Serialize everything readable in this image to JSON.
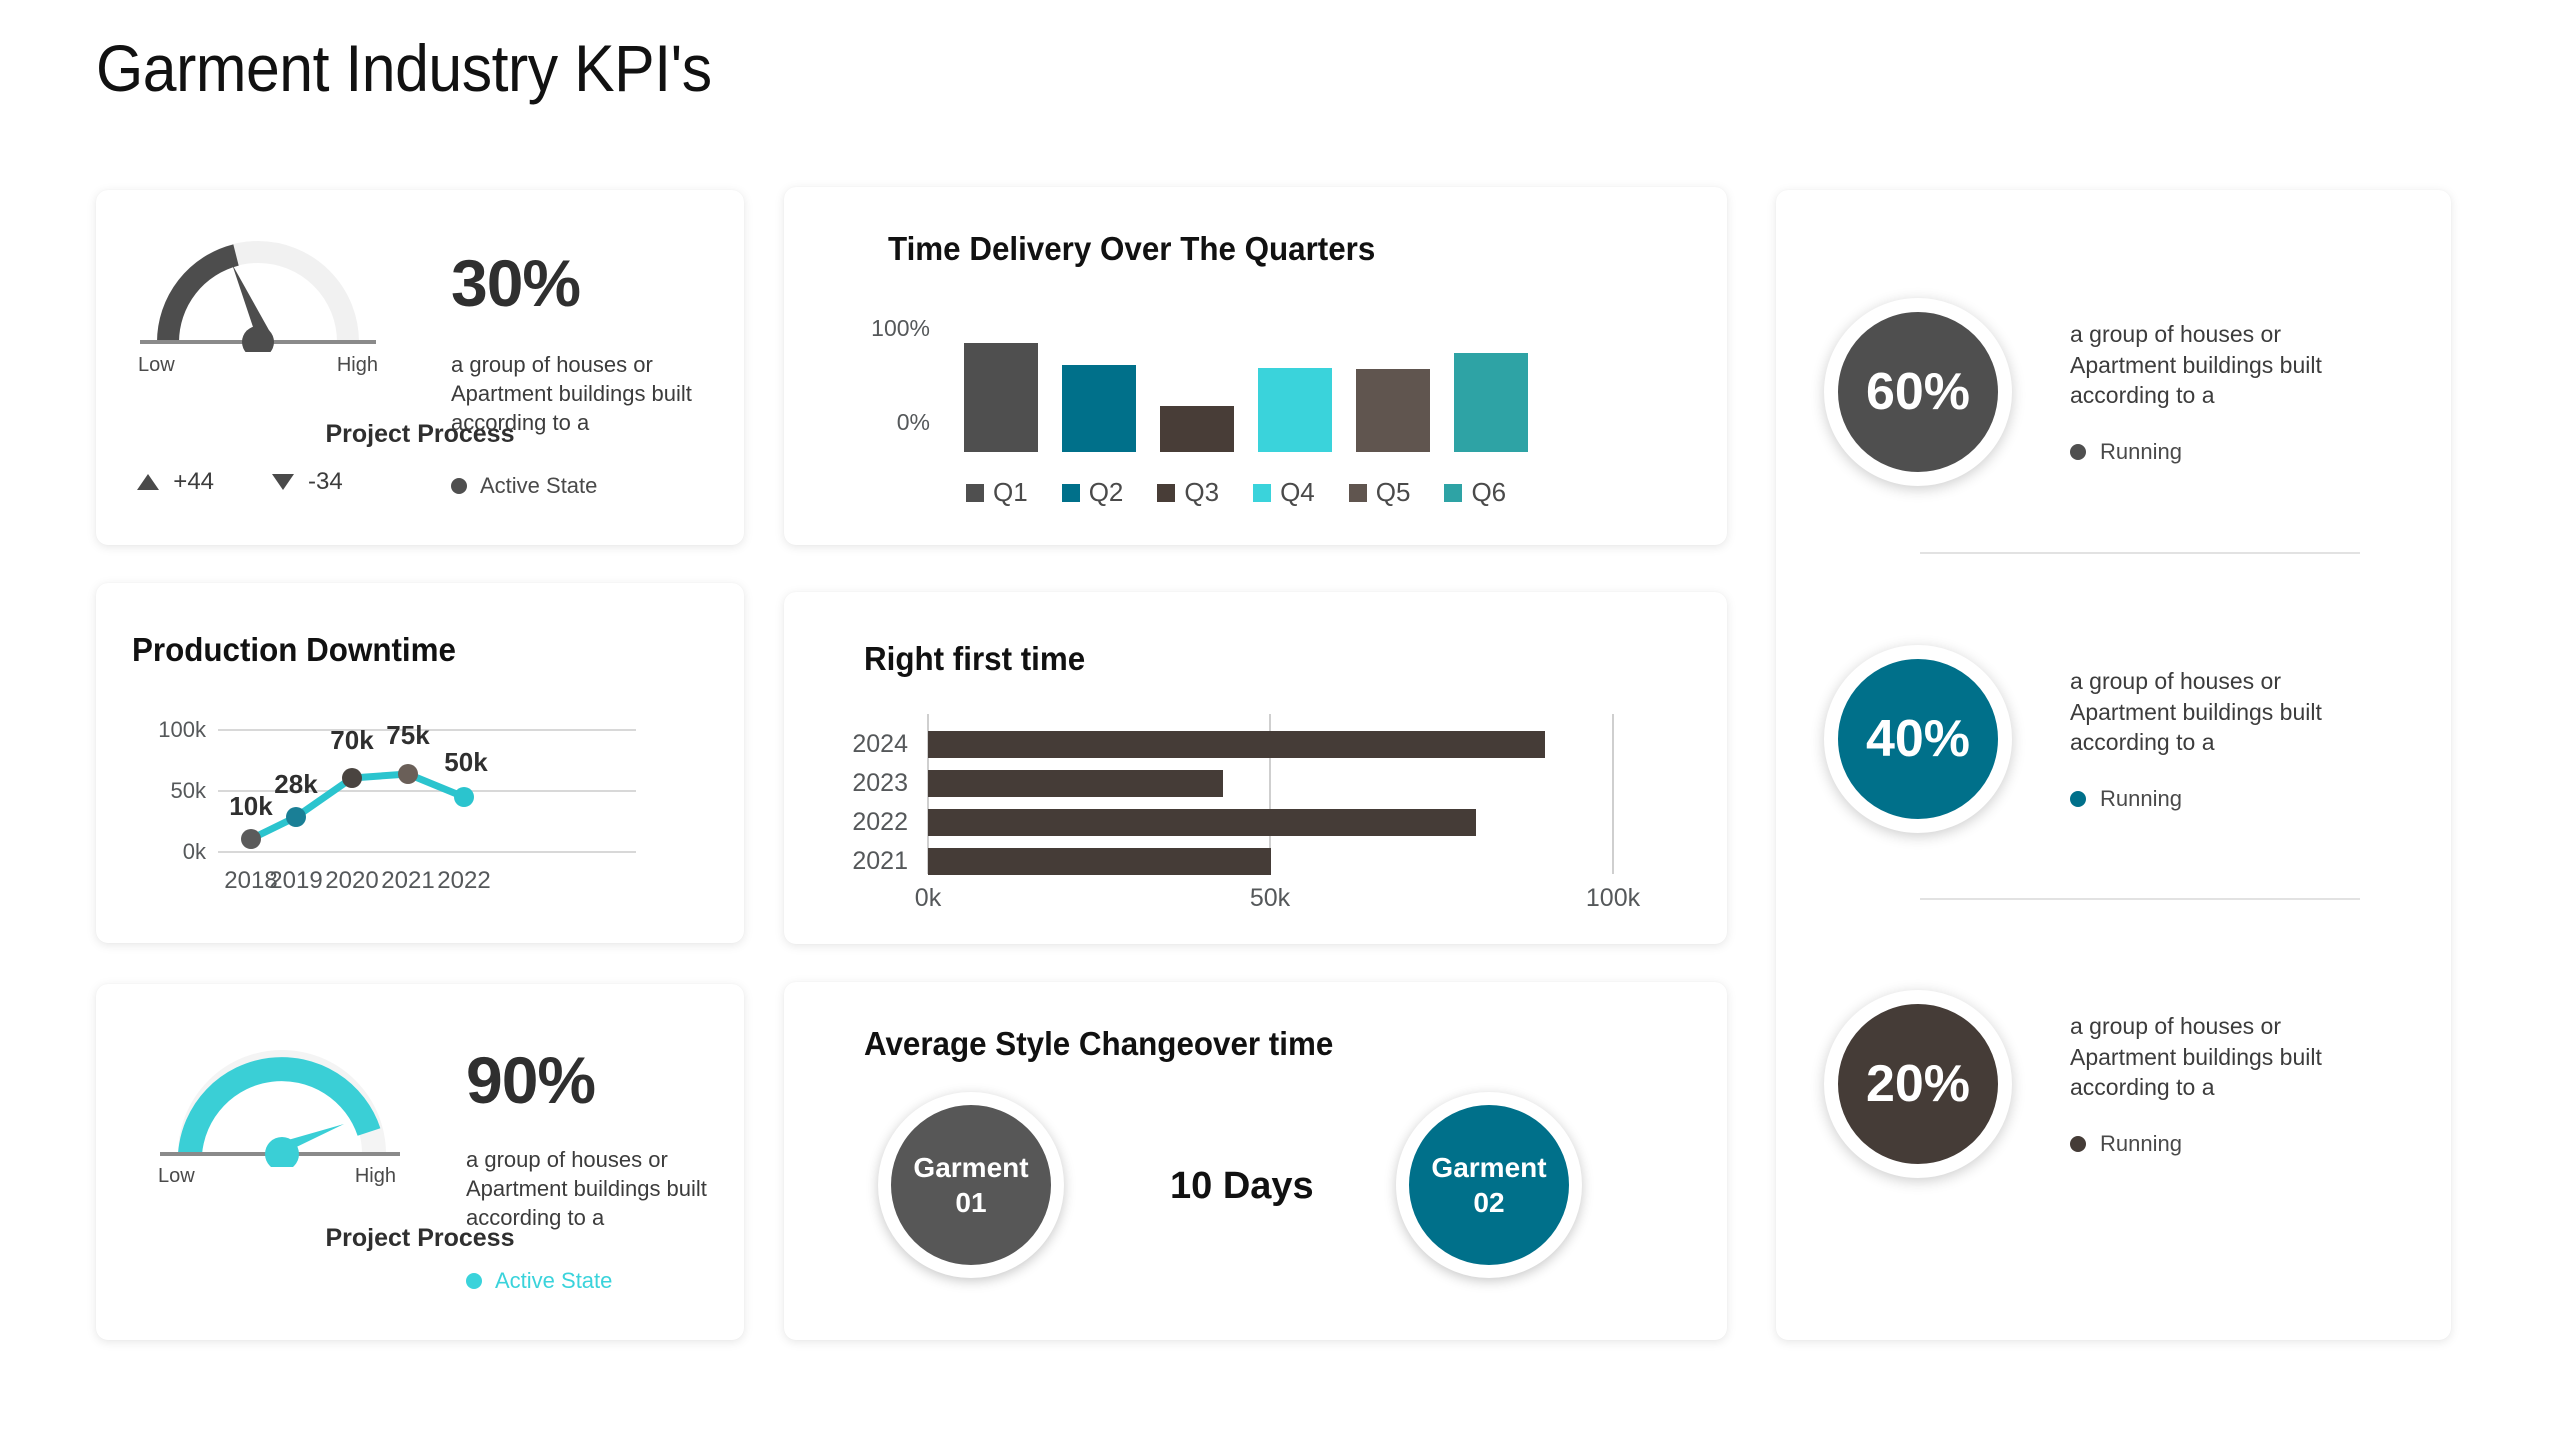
{
  "page": {
    "title": "Garment Industry KPI's",
    "background_color": "#ffffff"
  },
  "palette": {
    "gray": "#4F4F4F",
    "teal_blue": "#00708A",
    "dark_brown": "#453C37",
    "cyan": "#3AD3DB",
    "warm_gray": "#60554F",
    "teal": "#2EA3A5",
    "line_cyan": "#2BC4CE",
    "text": "#2f2f2f",
    "muted": "#55585a"
  },
  "gauge_top": {
    "card_name": "project-process-gauge-top",
    "value_percent": 30,
    "value_label": "30%",
    "low_label": "Low",
    "high_label": "High",
    "caption": "Project Process",
    "delta_up": "+44",
    "delta_down": "-34",
    "description": "a group of houses or Apartment buildings built according to a",
    "status_label": "Active State",
    "status_color": "#4F4F4F",
    "arc_color": "#4F4F4F",
    "track_color": "#f0f0f0"
  },
  "gauge_bottom": {
    "card_name": "project-process-gauge-bottom",
    "value_percent": 90,
    "value_label": "90%",
    "low_label": "Low",
    "high_label": "High",
    "caption": "Project Process",
    "description": "a group of houses or Apartment buildings built according to a",
    "status_label": "Active State",
    "status_color": "#3AD3DB",
    "arc_color": "#3AD3DB",
    "track_color": "#f2f2f2"
  },
  "changeover": {
    "title": "Average Style Changeover time",
    "days_label": "10 Days",
    "bubbles": [
      {
        "line1": "Garment",
        "line2": "01",
        "color": "#575757"
      },
      {
        "line1": "Garment",
        "line2": "02",
        "color": "#00708A"
      }
    ]
  },
  "right_stats": [
    {
      "value": "60%",
      "color": "#4F4F4F",
      "description": "a group of houses or Apartment buildings built according to a",
      "status_label": "Running",
      "status_color": "#4F4F4F"
    },
    {
      "value": "40%",
      "color": "#00708A",
      "description": "a group of houses or Apartment buildings built according to a",
      "status_label": "Running",
      "status_color": "#00708A"
    },
    {
      "value": "20%",
      "color": "#453C37",
      "description": "a group of houses or Apartment buildings built according to a",
      "status_label": "Running",
      "status_color": "#453C37"
    }
  ],
  "chart_data": [
    {
      "id": "time-delivery",
      "type": "bar",
      "title": "Time Delivery Over The Quarters",
      "xlabel": "",
      "ylabel": "",
      "categories": [
        "Q1",
        "Q2",
        "Q3",
        "Q4",
        "Q5",
        "Q6"
      ],
      "values": [
        75,
        60,
        32,
        58,
        57,
        68
      ],
      "ylim": [
        0,
        100
      ],
      "ytick_labels": [
        "100%",
        "0%"
      ],
      "ytick_values": [
        100,
        0
      ],
      "grid": false,
      "legend_position": "bottom",
      "legend": [
        "Q1",
        "Q2",
        "Q3",
        "Q4",
        "Q5",
        "Q6"
      ],
      "colors": [
        "#4F4F4F",
        "#00708A",
        "#483D37",
        "#3AD3DB",
        "#60554F",
        "#2EA3A5"
      ]
    },
    {
      "id": "production-downtime",
      "type": "line",
      "title": "Production Downtime",
      "xlabel": "",
      "ylabel": "",
      "categories": [
        "2018",
        "2019",
        "2020",
        "2021",
        "2022"
      ],
      "values": [
        10000,
        28000,
        70000,
        75000,
        50000
      ],
      "data_labels": [
        "10k",
        "28k",
        "70k",
        "75k",
        "50k"
      ],
      "ylim": [
        0,
        100000
      ],
      "ytick_labels": [
        "100k",
        "50k",
        "0k"
      ],
      "ytick_values": [
        100000,
        50000,
        0
      ],
      "grid": true,
      "line_color": "#2BC4CE",
      "marker_colors": [
        "#5b5b5b",
        "#1a7f96",
        "#4a4440",
        "#6a5f58",
        "#2BC4CE"
      ],
      "legend_position": "none"
    },
    {
      "id": "right-first-time",
      "type": "bar",
      "orientation": "horizontal",
      "title": "Right first time",
      "xlabel": "",
      "ylabel": "",
      "categories": [
        "2024",
        "2023",
        "2022",
        "2021"
      ],
      "values": [
        90000,
        43000,
        80000,
        50000
      ],
      "xlim": [
        0,
        105000
      ],
      "xtick_labels": [
        "0k",
        "50k",
        "100k"
      ],
      "xtick_values": [
        0,
        50000,
        100000
      ],
      "grid": true,
      "bar_color": "#453C37",
      "legend_position": "none"
    }
  ]
}
